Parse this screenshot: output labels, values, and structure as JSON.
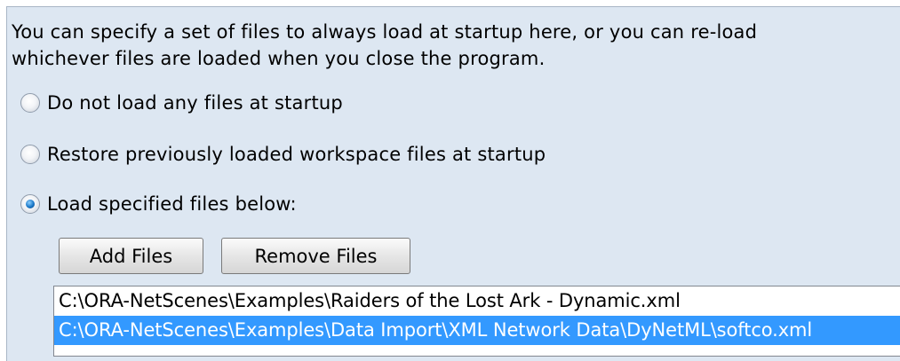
{
  "description": [
    "You can specify a set of files to always load at startup here, or you can re-load",
    "whichever files are loaded when you close the program."
  ],
  "options": [
    {
      "label": "Do not load any files at startup",
      "checked": false
    },
    {
      "label": "Restore previously loaded workspace files at startup",
      "checked": false
    },
    {
      "label": "Load specified files below:",
      "checked": true
    }
  ],
  "buttons": {
    "add_files": "Add Files",
    "remove_files": "Remove Files"
  },
  "files": [
    {
      "path": "C:\\ORA-NetScenes\\Examples\\Raiders of the Lost Ark - Dynamic.xml",
      "selected": false
    },
    {
      "path": "C:\\ORA-NetScenes\\Examples\\Data Import\\XML Network Data\\DyNetML\\softco.xml",
      "selected": true
    }
  ],
  "colors": {
    "panel_bg": "#dde7f2",
    "selection": "#3399ff",
    "radio_checked": "#1a78c8"
  }
}
